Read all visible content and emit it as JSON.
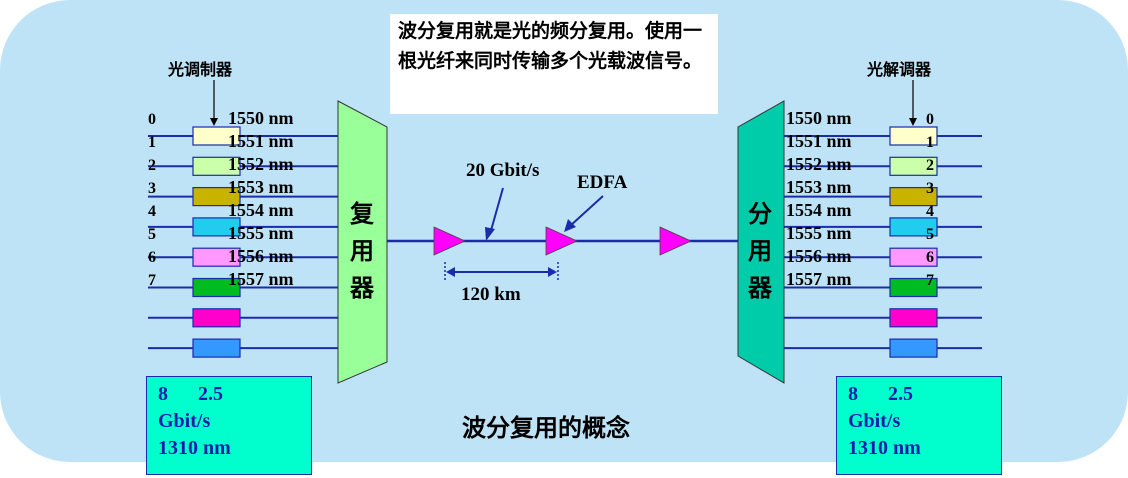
{
  "callout": {
    "text": "波分复用就是光的频分复用。使用一根光纤来同时传输多个光载波信号。"
  },
  "left": {
    "label": "光调制器",
    "mux_label": [
      "复",
      "用",
      "器"
    ],
    "channel_indices": [
      "0",
      "1",
      "2",
      "3",
      "4",
      "5",
      "6",
      "7"
    ],
    "wavelengths": [
      "1550 nm",
      "1551 nm",
      "1552 nm",
      "1553 nm",
      "1554 nm",
      "1555 nm",
      "1556 nm",
      "1557 nm"
    ],
    "box": {
      "count": "8",
      "rate": "2.5",
      "unit": "Gbit/s",
      "wavelength": "1310 nm"
    }
  },
  "right": {
    "label": "光解调器",
    "demux_label": [
      "分",
      "用",
      "器"
    ],
    "channel_indices": [
      "0",
      "1",
      "2",
      "3",
      "4",
      "5",
      "6",
      "7"
    ],
    "wavelengths": [
      "1550 nm",
      "1551 nm",
      "1552 nm",
      "1553 nm",
      "1554 nm",
      "1555 nm",
      "1556 nm",
      "1557 nm"
    ],
    "box": {
      "count": "8",
      "rate": "2.5",
      "unit": "Gbit/s",
      "wavelength": "1310 nm"
    }
  },
  "link": {
    "rate": "20 Gbit/s",
    "amplifier": "EDFA",
    "span": "120 km"
  },
  "caption": "波分复用的概念",
  "colors": {
    "background": "#bfe3f6",
    "fiber": "#1a2ca8",
    "mux_fill": "#99ff99",
    "demux_fill": "#00ccaa",
    "amplifier": "#ff00ff",
    "channel_boxes": [
      "#ffffcc",
      "#ccffaa",
      "#c8b400",
      "#22ccee",
      "#ff99ff",
      "#00bb22",
      "#ff00cc",
      "#3399ff"
    ]
  }
}
